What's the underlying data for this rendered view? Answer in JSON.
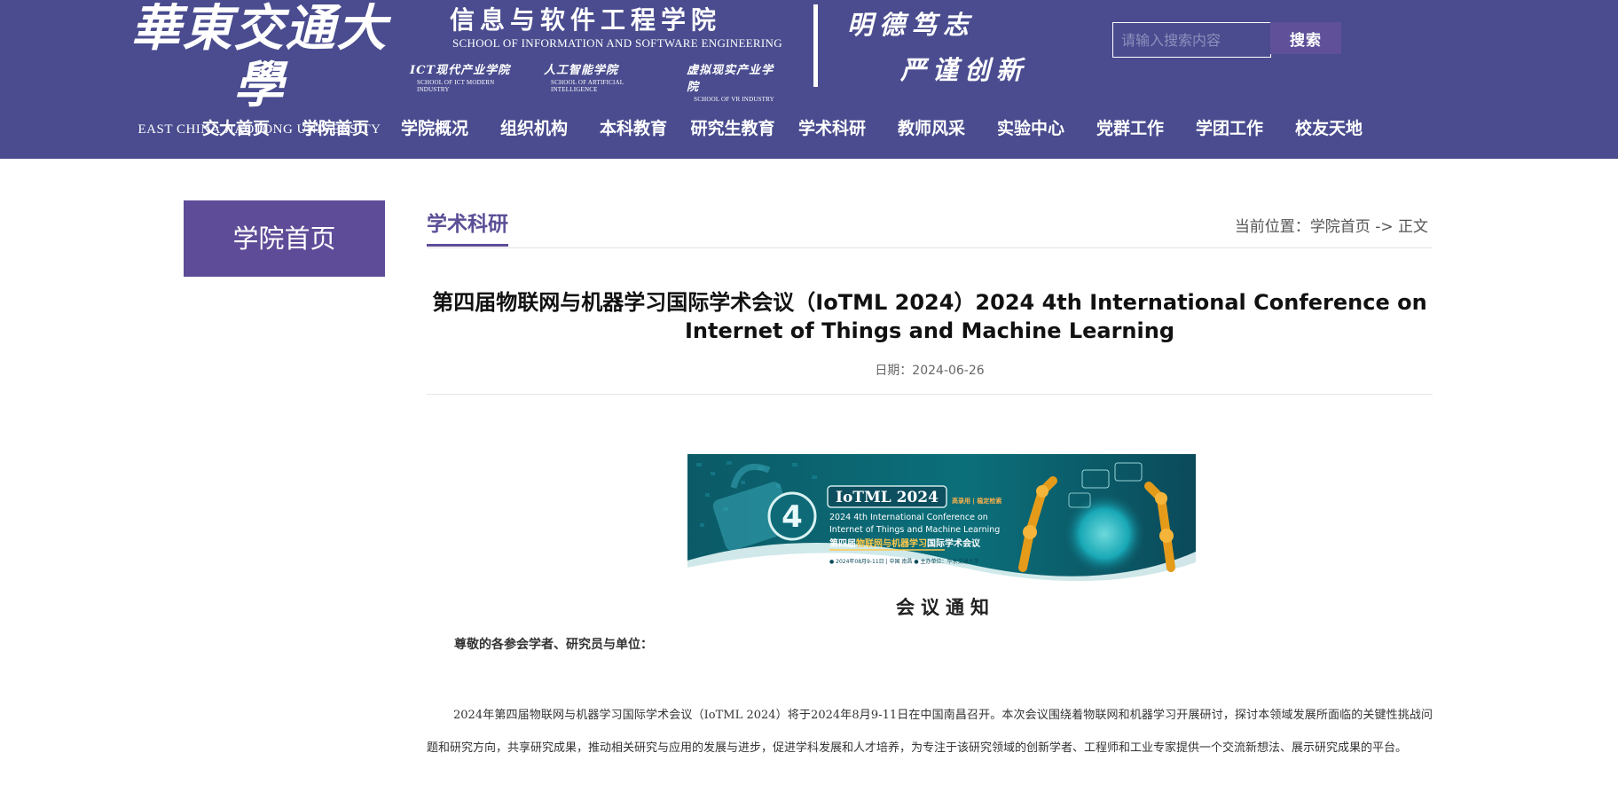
{
  "header": {
    "university_cn": "華東交通大學",
    "university_en": "EAST CHINA JIAOTONG UNIVERSITY",
    "school_cn": "信息与软件工程学院",
    "school_en": "SCHOOL OF INFORMATION AND SOFTWARE ENGINEERING",
    "sub_schools": [
      {
        "cn": "ICT现代产业学院",
        "en": "SCHOOL OF ICT MODERN INDUSTRY"
      },
      {
        "cn": "人工智能学院",
        "en": "SCHOOL OF ARTIFICIAL INTELLIGENCE"
      },
      {
        "cn": "虚拟现实产业学院",
        "en": "SCHOOL OF VR INDUSTRY"
      }
    ],
    "motto_line1": "明德笃志",
    "motto_line2": "严谨创新",
    "search_placeholder": "请输入搜索内容",
    "search_button": "搜索"
  },
  "nav": [
    {
      "label": "交大首页"
    },
    {
      "label": "学院首页"
    },
    {
      "label": "学院概况"
    },
    {
      "label": "组织机构"
    },
    {
      "label": "本科教育"
    },
    {
      "label": "研究生教育"
    },
    {
      "label": "学术科研"
    },
    {
      "label": "教师风采"
    },
    {
      "label": "实验中心"
    },
    {
      "label": "党群工作"
    },
    {
      "label": "学团工作"
    },
    {
      "label": "校友天地"
    }
  ],
  "sidebar": {
    "title": "学院首页"
  },
  "section": {
    "title": "学术科研",
    "breadcrumb_prefix": "当前位置：",
    "breadcrumb_home": "学院首页",
    "breadcrumb_sep": " -> ",
    "breadcrumb_current": "正文"
  },
  "article": {
    "title": "第四届物联网与机器学习国际学术会议（IoTML 2024）2024 4th International Conference on Internet of Things and Machine Learning",
    "date": "日期：2024-06-26",
    "banner": {
      "title": "IoTML 2024",
      "tag": "高录用 | 稳定检索",
      "num": "4",
      "line1": "2024 4th International Conference on",
      "line2": "Internet of Things and Machine Learning",
      "line3_pre": "第四届",
      "line3_hl": "物联网与机器学习",
      "line3_post": "国际学术会议",
      "footer": "● 2024年08月9-11日 | 中国 南昌    ● 主办单位：华东交通大学"
    },
    "caption": "会议通知",
    "salutation": "尊敬的各参会学者、研究员与单位：",
    "paragraph": "2024年第四届物联网与机器学习国际学术会议（IoTML 2024）将于2024年8月9-11日在中国南昌召开。本次会议围绕着物联网和机器学习开展研讨，探讨本领域发展所面临的关键性挑战问题和研究方向，共享研究成果，推动相关研究与应用的发展与进步，促进学科发展和人才培养，为专注于该研究领域的创新学者、工程师和工业专家提供一个交流新想法、展示研究成果的平台。"
  },
  "colors": {
    "header_bg": "#4a4c8f",
    "accent_purple": "#5f4c98",
    "search_button_bg": "#5f5099"
  }
}
